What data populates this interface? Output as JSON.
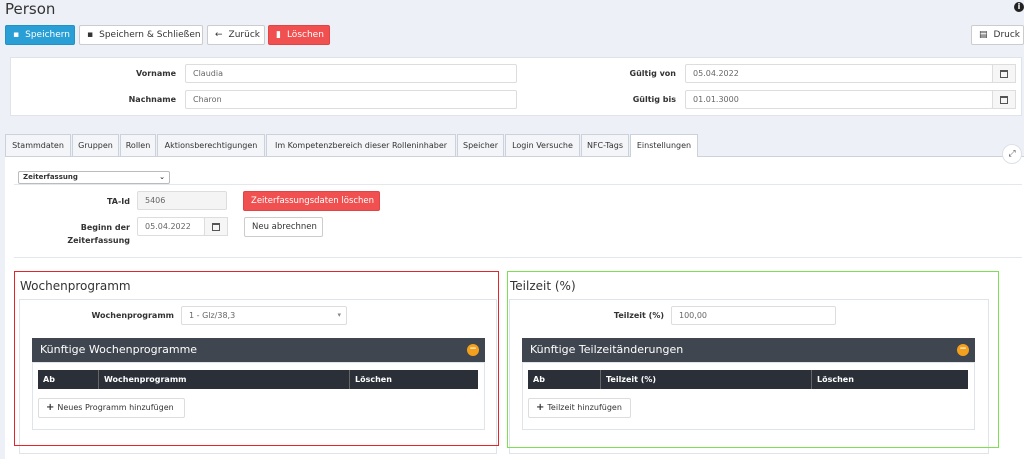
{
  "page": {
    "title": "Person"
  },
  "toolbar": {
    "save": "Speichern",
    "save_close": "Speichern & Schließen",
    "back": "Zurück",
    "delete": "Löschen",
    "print": "Druck"
  },
  "header_form": {
    "firstname_label": "Vorname",
    "firstname_value": "Claudia",
    "lastname_label": "Nachname",
    "lastname_value": "Charon",
    "valid_from_label": "Gültig von",
    "valid_from_value": "05.04.2022",
    "valid_to_label": "Gültig bis",
    "valid_to_value": "01.01.3000"
  },
  "tabs": [
    {
      "label": "Stammdaten"
    },
    {
      "label": "Gruppen"
    },
    {
      "label": "Rollen"
    },
    {
      "label": "Aktionsberechtigungen"
    },
    {
      "label": "Im Kompetenzbereich dieser Rolleninhaber"
    },
    {
      "label": "Speicher"
    },
    {
      "label": "Login Versuche"
    },
    {
      "label": "NFC-Tags"
    },
    {
      "label": "Einstellungen"
    }
  ],
  "settings": {
    "section_select": "Zeiterfassung",
    "ta_id_label": "TA-Id",
    "ta_id_value": "5406",
    "clear_button": "Zeiterfassungsdaten löschen",
    "start_label_line1": "Beginn der",
    "start_label_line2": "Zeiterfassung",
    "start_value": "05.04.2022",
    "recalc_button": "Neu abrechnen"
  },
  "weekly": {
    "title": "Wochenprogramm",
    "field_label": "Wochenprogramm",
    "field_value": "1 - Glz/38,3",
    "future_header": "Künftige Wochenprogramme",
    "columns": [
      "Ab",
      "Wochenprogramm",
      "Löschen"
    ],
    "add_button": "Neues Programm hinzufügen"
  },
  "parttime": {
    "title": "Teilzeit (%)",
    "field_label": "Teilzeit (%)",
    "field_value": "100,00",
    "future_header": "Künftige Teilzeitänderungen",
    "columns": [
      "Ab",
      "Teilzeit (%)",
      "Löschen"
    ],
    "add_button": "Teilzeit hinzufügen"
  },
  "colors": {
    "primary": "#2a9fd6",
    "danger": "#f05050",
    "dark_header": "#3f464f",
    "highlight_red": "#e3262a",
    "highlight_green": "#7de050"
  }
}
